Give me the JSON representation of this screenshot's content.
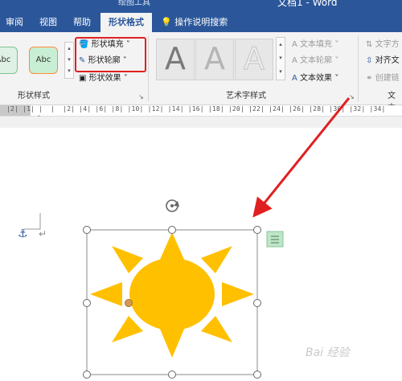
{
  "window": {
    "title": "文档1 - Word",
    "context_group": "绘图工具"
  },
  "tabs": [
    {
      "label": "审阅"
    },
    {
      "label": "视图"
    },
    {
      "label": "帮助"
    },
    {
      "label": "形状格式",
      "active": true
    }
  ],
  "tell_me": "操作说明搜索",
  "ribbon": {
    "shape_styles": {
      "preset1": "Abc",
      "preset2": "Abc",
      "fill": "形状填充",
      "outline": "形状轮廓",
      "effects": "形状效果",
      "group_label": "形状样式"
    },
    "wordart": {
      "tile1": "A",
      "tile2": "A",
      "tile3": "A",
      "text_fill": "文本填充",
      "text_outline": "文本轮廓",
      "text_effects": "文本效果",
      "group_label": "艺术字样式"
    },
    "text_group": {
      "direction": "文字方",
      "align": "对齐文",
      "link": "创建链",
      "group_label": "文本"
    }
  },
  "ruler": {
    "text": "|2| |1| |  |  |2| |4| |6| |8| |10| |12| |14| |16| |18| |20| |22| |24| |26| |28| |30| |32| |34|"
  },
  "document": {
    "paragraph_mark": "↵",
    "anchor_icon": "⚓"
  },
  "colors": {
    "accent": "#2b579a",
    "sun": "#ffc000",
    "highlight": "#e02020",
    "layout_badge": "#bfe6c8"
  },
  "watermark": "Bai 经验"
}
